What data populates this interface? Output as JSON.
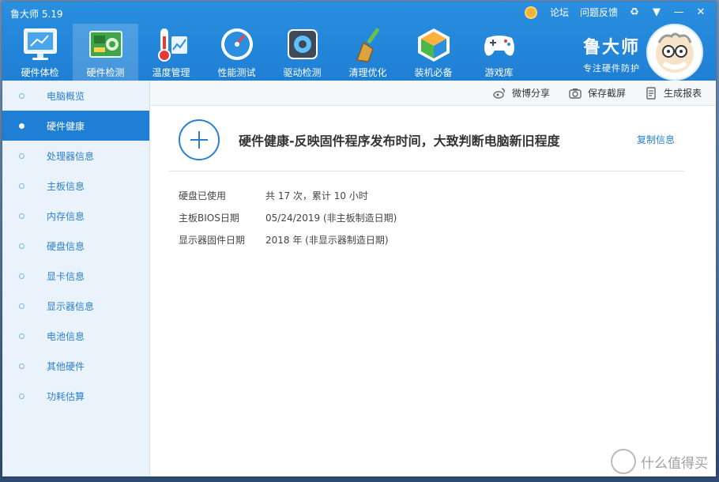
{
  "app": {
    "title": "鲁大师 5.19"
  },
  "topbar": {
    "forum": "论坛",
    "feedback": "问题反馈",
    "skin_icon": "♻",
    "menu_icon": "▼",
    "min_icon": "—",
    "close_icon": "✕"
  },
  "nav": [
    {
      "label": "硬件体检",
      "icon": "monitor-icon"
    },
    {
      "label": "硬件检测",
      "icon": "board-icon"
    },
    {
      "label": "温度管理",
      "icon": "thermometer-icon"
    },
    {
      "label": "性能测试",
      "icon": "gauge-icon"
    },
    {
      "label": "驱动检测",
      "icon": "gear-icon"
    },
    {
      "label": "清理优化",
      "icon": "broom-icon"
    },
    {
      "label": "装机必备",
      "icon": "cube-icon"
    },
    {
      "label": "游戏库",
      "icon": "gamepad-icon"
    }
  ],
  "brand": {
    "name": "鲁大师",
    "slogan": "专注硬件防护"
  },
  "sidebar": {
    "items": [
      "电脑概览",
      "硬件健康",
      "处理器信息",
      "主板信息",
      "内存信息",
      "硬盘信息",
      "显卡信息",
      "显示器信息",
      "电池信息",
      "其他硬件",
      "功耗估算"
    ],
    "active": 1
  },
  "toolbar": {
    "share": "微博分享",
    "screenshot": "保存截屏",
    "report": "生成报表"
  },
  "content": {
    "headline": "硬件健康-反映固件程序发布时间，大致判断电脑新旧程度",
    "copy": "复制信息",
    "rows": [
      {
        "k": "硬盘已使用",
        "v": "共 17 次，累计 10 小时"
      },
      {
        "k": "主板BIOS日期",
        "v": "05/24/2019 (非主板制造日期)"
      },
      {
        "k": "显示器固件日期",
        "v": "2018 年 (非显示器制造日期)"
      }
    ]
  },
  "watermark": "什么值得买"
}
